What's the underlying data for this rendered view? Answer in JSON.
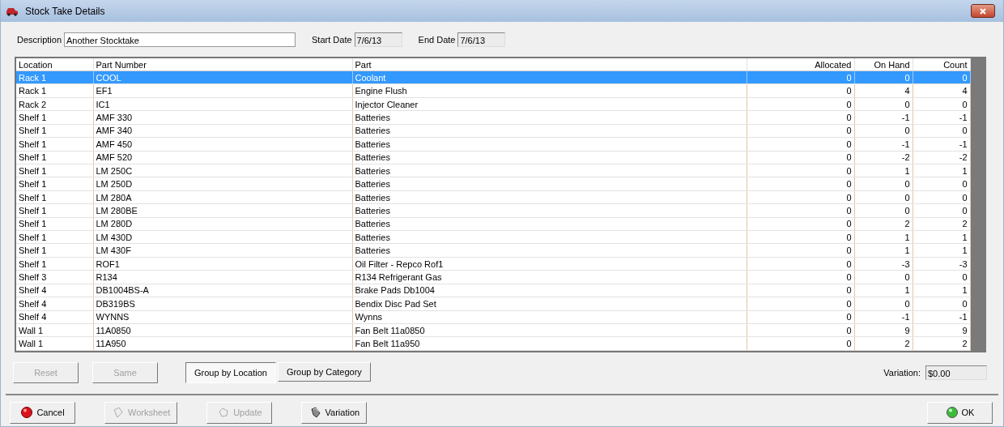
{
  "window": {
    "title": "Stock Take Details"
  },
  "header": {
    "description_label": "Description",
    "description": "Another Stocktake",
    "start_label": "Start Date",
    "start_date": "7/6/13",
    "end_label": "End Date",
    "end_date": "7/6/13"
  },
  "table": {
    "columns": [
      "Location",
      "Part Number",
      "Part",
      "Allocated",
      "On Hand",
      "Count"
    ],
    "rows": [
      {
        "selected": true,
        "cells": [
          "Rack 1",
          "COOL",
          "Coolant",
          "0",
          "0",
          "0"
        ]
      },
      {
        "selected": false,
        "cells": [
          "Rack 1",
          "EF1",
          "Engine Flush",
          "0",
          "4",
          "4"
        ]
      },
      {
        "selected": false,
        "cells": [
          "Rack 2",
          "IC1",
          "Injector Cleaner",
          "0",
          "0",
          "0"
        ]
      },
      {
        "selected": false,
        "cells": [
          "Shelf 1",
          "AMF 330",
          "Batteries",
          "0",
          "-1",
          "-1"
        ]
      },
      {
        "selected": false,
        "cells": [
          "Shelf 1",
          "AMF 340",
          "Batteries",
          "0",
          "0",
          "0"
        ]
      },
      {
        "selected": false,
        "cells": [
          "Shelf 1",
          "AMF 450",
          "Batteries",
          "0",
          "-1",
          "-1"
        ]
      },
      {
        "selected": false,
        "cells": [
          "Shelf 1",
          "AMF 520",
          "Batteries",
          "0",
          "-2",
          "-2"
        ]
      },
      {
        "selected": false,
        "cells": [
          "Shelf 1",
          "LM 250C",
          "Batteries",
          "0",
          "1",
          "1"
        ]
      },
      {
        "selected": false,
        "cells": [
          "Shelf 1",
          "LM 250D",
          "Batteries",
          "0",
          "0",
          "0"
        ]
      },
      {
        "selected": false,
        "cells": [
          "Shelf 1",
          "LM 280A",
          "Batteries",
          "0",
          "0",
          "0"
        ]
      },
      {
        "selected": false,
        "cells": [
          "Shelf 1",
          "LM 280BE",
          "Batteries",
          "0",
          "0",
          "0"
        ]
      },
      {
        "selected": false,
        "cells": [
          "Shelf 1",
          "LM 280D",
          "Batteries",
          "0",
          "2",
          "2"
        ]
      },
      {
        "selected": false,
        "cells": [
          "Shelf 1",
          "LM 430D",
          "Batteries",
          "0",
          "1",
          "1"
        ]
      },
      {
        "selected": false,
        "cells": [
          "Shelf 1",
          "LM 430F",
          "Batteries",
          "0",
          "1",
          "1"
        ]
      },
      {
        "selected": false,
        "cells": [
          "Shelf 1",
          "ROF1",
          "Oil Filter - Repco Rof1",
          "0",
          "-3",
          "-3"
        ]
      },
      {
        "selected": false,
        "cells": [
          "Shelf 3",
          "R134",
          "R134 Refrigerant Gas",
          "0",
          "0",
          "0"
        ]
      },
      {
        "selected": false,
        "cells": [
          "Shelf 4",
          "DB1004BS-A",
          "Brake Pads Db1004",
          "0",
          "1",
          "1"
        ]
      },
      {
        "selected": false,
        "cells": [
          "Shelf 4",
          "DB319BS",
          "Bendix Disc Pad Set",
          "0",
          "0",
          "0"
        ]
      },
      {
        "selected": false,
        "cells": [
          "Shelf 4",
          "WYNNS",
          "Wynns",
          "0",
          "-1",
          "-1"
        ]
      },
      {
        "selected": false,
        "cells": [
          "Wall 1",
          "11A0850",
          "Fan Belt 11a0850",
          "0",
          "9",
          "9"
        ]
      },
      {
        "selected": false,
        "cells": [
          "Wall 1",
          "11A950",
          "Fan Belt 11a950",
          "0",
          "2",
          "2"
        ]
      }
    ]
  },
  "actions": [
    {
      "label": "Reset",
      "disabled": true
    },
    {
      "label": "Same",
      "disabled": true
    }
  ],
  "grouping": [
    {
      "label": "Group by Location",
      "selected": true
    },
    {
      "label": "Group by Category",
      "selected": false
    }
  ],
  "variation": {
    "label": "Variation:",
    "value": "$0.00"
  },
  "footer": [
    {
      "label": "Cancel",
      "disabled": false
    },
    {
      "label": "Worksheet",
      "disabled": true
    },
    {
      "label": "Update",
      "disabled": true
    },
    {
      "label": "Variation",
      "disabled": false
    }
  ],
  "ok": {
    "label": "OK",
    "disabled": false
  }
}
